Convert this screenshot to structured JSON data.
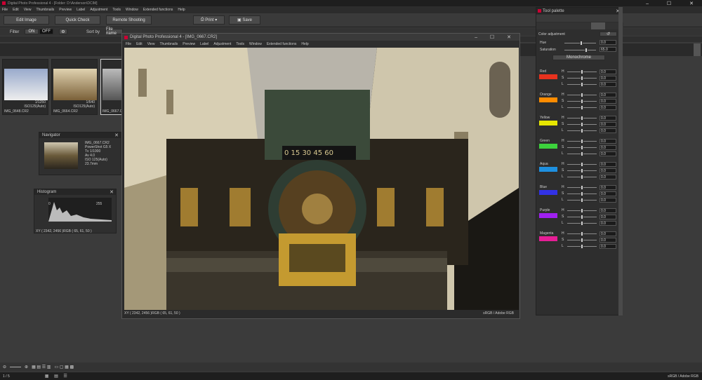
{
  "app": {
    "title": "Digital Photo Professional 4 - [Folder: D:\\Anderson\\DCIM]"
  },
  "menu": [
    "File",
    "Edit",
    "View",
    "Thumbnails",
    "Preview",
    "Label",
    "Adjustment",
    "Tools",
    "Window",
    "Extended functions",
    "Help"
  ],
  "toolbar": {
    "edit_image": "Edit Image",
    "quick_check": "Quick Check",
    "remote_shooting": "Remote Shooting",
    "print": "Print",
    "save": "Save"
  },
  "filterbar": {
    "filter": "Filter",
    "on": "ON",
    "off": "OFF",
    "sort_by": "Sort by",
    "sort_value": "File name"
  },
  "thumbnails": [
    {
      "name": "IMG_0648.CR2",
      "shutter": "1/1250",
      "iso": "ISO125(Auto)"
    },
    {
      "name": "IMG_0664.CR2",
      "shutter": "1/640",
      "iso": "ISO125(Auto)"
    },
    {
      "name": "IMG_0667.CR2",
      "shutter": "",
      "iso": ""
    }
  ],
  "navigator": {
    "title": "Navigator",
    "info": [
      "IMG_0667.CR2",
      "PowerShot G5 X",
      "Tv 1/1000",
      "Av 4.0",
      "ISO 125(Auto)",
      "23.7mm"
    ]
  },
  "histogram": {
    "title": "Histogram",
    "min": "0",
    "max": "255",
    "readout": "XY ( 2342, 2456 )RGB ( 65, 61, 50 )"
  },
  "edit_window": {
    "title": "Digital Photo Professional 4 - [IMG_0667.CR2]",
    "menu": [
      "File",
      "Edit",
      "View",
      "Thumbnails",
      "Preview",
      "Label",
      "Adjustment",
      "Tools",
      "Window",
      "Extended functions",
      "Help"
    ],
    "status_left": "XY ( 2342, 2456 )RGB ( 65, 61, 50 )",
    "status_right": "sRGB / Adobe RGB"
  },
  "clock_numbers": "0 15 30 45 60",
  "tool_palette": {
    "title": "Tool palette",
    "section": "Color adjustment",
    "hue": "Hue",
    "saturation": "Saturation",
    "hue_val": "0.0",
    "sat_val": "65.0",
    "monochrome": "Monochrome",
    "colors": [
      {
        "name": "Red",
        "swatch": "#e8321e"
      },
      {
        "name": "Orange",
        "swatch": "#ff8c00"
      },
      {
        "name": "Yellow",
        "swatch": "#e6e600"
      },
      {
        "name": "Green",
        "swatch": "#3cd23c"
      },
      {
        "name": "Aqua",
        "swatch": "#1e90e0"
      },
      {
        "name": "Blue",
        "swatch": "#3232e6"
      },
      {
        "name": "Purple",
        "swatch": "#a020f0"
      },
      {
        "name": "Magenta",
        "swatch": "#e61e96"
      }
    ],
    "h": "H",
    "s": "S",
    "l": "L",
    "v": "0.0"
  },
  "statusbar": {
    "count": "1 / 5",
    "colorspace": "sRGB / Adobe RGB"
  }
}
